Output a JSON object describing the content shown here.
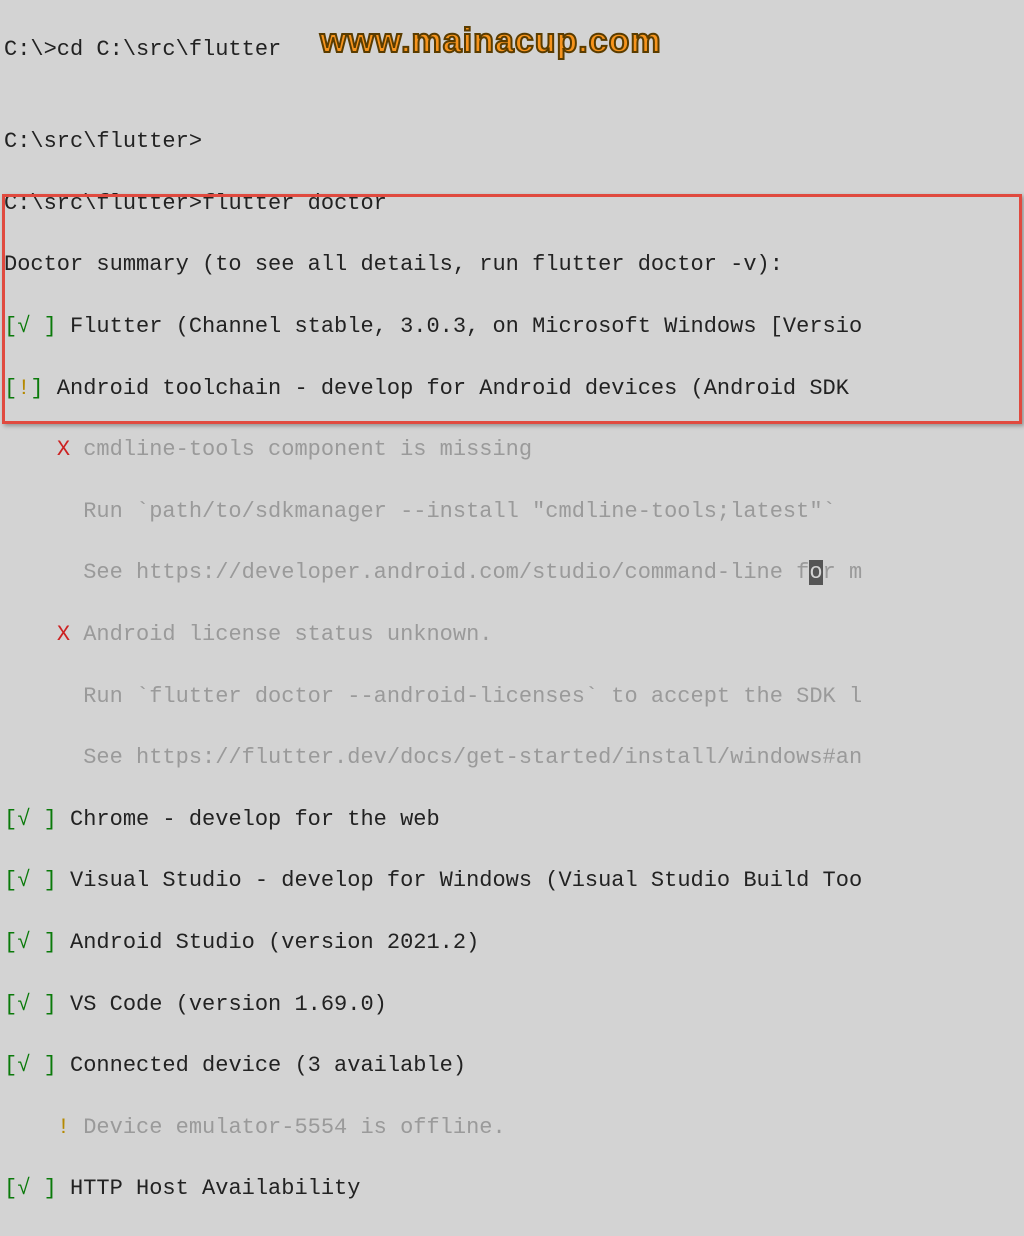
{
  "watermark": "www.mainacup.com",
  "lines": {
    "l1": "C:\\>cd C:\\src\\flutter",
    "l2": "",
    "l3": "C:\\src\\flutter>",
    "l4_prompt": "C:\\src\\flutter>",
    "l4_cmd": "flutter doctor",
    "l5": "Doctor summary (to see all details, run flutter doctor -v):",
    "l6_text": " Flutter (Channel stable, 3.0.3, on Microsoft Windows [Versio",
    "l7_text": " Android toolchain - develop for Android devices (Android SDK ",
    "l8_x": "X",
    "l8_text": " cmdline-tools component is missing",
    "l9_text": "      Run `path/to/sdkmanager --install \"cmdline-tools;latest\"`",
    "l10_a": "      See https://developer.android.com/studio/command-line f",
    "l10_b": "o",
    "l10_c": "r m",
    "l11_x": "X",
    "l11_text": " Android license status unknown.",
    "l12_text": "      Run `flutter doctor --android-licenses` to accept the SDK l",
    "l13_text": "      See https://flutter.dev/docs/get-started/install/windows#an",
    "l14_text": " Chrome - develop for the web",
    "l15_text": " Visual Studio - develop for Windows (Visual Studio Build Too",
    "l16_text": " Android Studio (version 2021.2)",
    "l17_text": " VS Code (version 1.69.0)",
    "l18_text": " Connected device (3 available)",
    "l19_mark": "!",
    "l19_text": " Device emulator-5554 is offline.",
    "l20_text": " HTTP Host Availability",
    "status_ok_open": "[",
    "status_ok_mark": "√",
    "status_ok_space": " ",
    "status_ok_close": "]",
    "status_warn_open": "[",
    "status_warn_mark": "!",
    "status_warn_close": "]",
    "indent4": "    "
  }
}
